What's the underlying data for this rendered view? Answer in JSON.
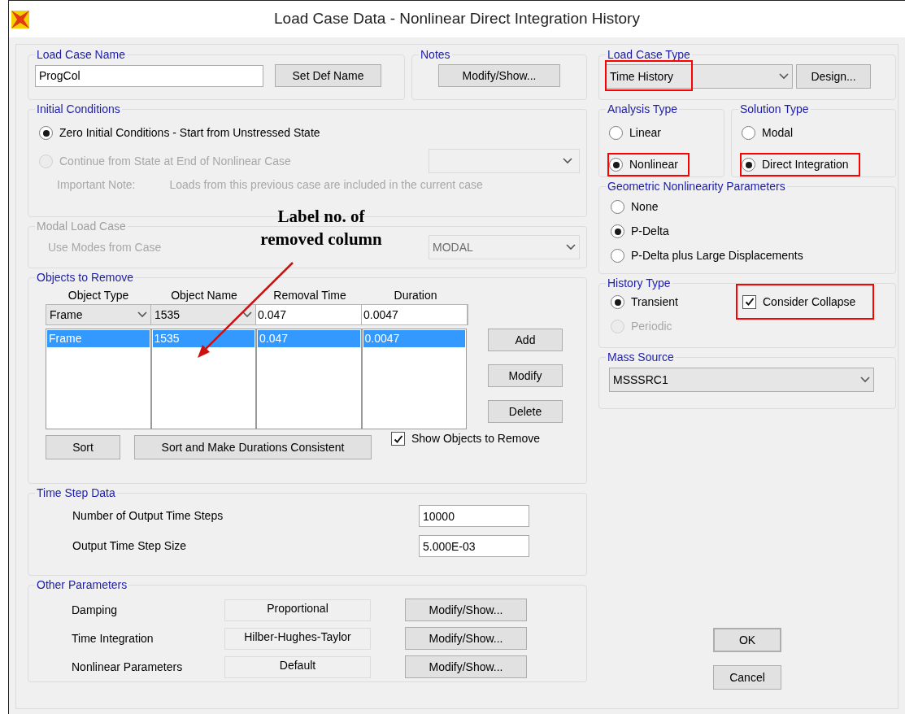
{
  "window": {
    "title": "Load Case Data - Nonlinear Direct Integration History"
  },
  "load_case_name": {
    "legend": "Load Case Name",
    "value": "ProgCol",
    "button": "Set Def Name"
  },
  "notes": {
    "legend": "Notes",
    "button": "Modify/Show..."
  },
  "initial_conditions": {
    "legend": "Initial Conditions",
    "options": [
      {
        "label": "Zero Initial Conditions - Start from Unstressed State",
        "selected": true,
        "disabled": false
      },
      {
        "label": "Continue from State at End of Nonlinear Case",
        "selected": false,
        "disabled": true
      }
    ],
    "note_label": "Important Note:",
    "note": "Loads from this previous case are included in the current case"
  },
  "modal_load_case": {
    "legend": "Modal Load Case",
    "label": "Use Modes from Case",
    "value": "MODAL",
    "disabled": true
  },
  "objects_to_remove": {
    "legend": "Objects to Remove",
    "columns": [
      "Object Type",
      "Object Name",
      "Removal Time",
      "Duration"
    ],
    "entry": [
      "Frame",
      "1535",
      "0.047",
      "0.0047"
    ],
    "rows": [
      {
        "cells": [
          "Frame",
          "1535",
          "0.047",
          "0.0047"
        ],
        "selected": true
      }
    ],
    "buttons": [
      "Add",
      "Modify",
      "Delete"
    ],
    "sort_buttons": [
      "Sort",
      "Sort and Make Durations Consistent"
    ],
    "show_objects": {
      "label": "Show Objects to Remove",
      "checked": true
    }
  },
  "time_step_data": {
    "legend": "Time Step Data",
    "fields": [
      {
        "label": "Number of Output Time Steps",
        "value": "10000"
      },
      {
        "label": "Output Time Step Size",
        "value": "5.000E-03"
      }
    ]
  },
  "other_parameters": {
    "legend": "Other Parameters",
    "rows": [
      {
        "label": "Damping",
        "value": "Proportional",
        "button": "Modify/Show..."
      },
      {
        "label": "Time Integration",
        "value": "Hilber-Hughes-Taylor",
        "button": "Modify/Show..."
      },
      {
        "label": "Nonlinear Parameters",
        "value": "Default",
        "button": "Modify/Show..."
      }
    ]
  },
  "load_case_type": {
    "legend": "Load Case Type",
    "value": "Time History",
    "highlighted": true,
    "button": "Design..."
  },
  "analysis_type": {
    "legend": "Analysis Type",
    "options": [
      {
        "label": "Linear",
        "selected": false,
        "highlighted": false
      },
      {
        "label": "Nonlinear",
        "selected": true,
        "highlighted": true
      }
    ]
  },
  "solution_type": {
    "legend": "Solution Type",
    "options": [
      {
        "label": "Modal",
        "selected": false,
        "highlighted": false
      },
      {
        "label": "Direct Integration",
        "selected": true,
        "highlighted": true
      }
    ]
  },
  "geometric_nonlinearity": {
    "legend": "Geometric Nonlinearity Parameters",
    "options": [
      {
        "label": "None",
        "selected": false
      },
      {
        "label": "P-Delta",
        "selected": true
      },
      {
        "label": "P-Delta plus Large Displacements",
        "selected": false
      }
    ]
  },
  "history_type": {
    "legend": "History Type",
    "options": [
      {
        "label": "Transient",
        "selected": true,
        "disabled": false
      },
      {
        "label": "Periodic",
        "selected": false,
        "disabled": true
      }
    ],
    "consider_collapse": {
      "label": "Consider Collapse",
      "checked": true,
      "highlighted": true
    }
  },
  "mass_source": {
    "legend": "Mass Source",
    "value": "MSSSRC1"
  },
  "buttons": [
    "OK",
    "Cancel"
  ],
  "annotation": {
    "text": "Label no. of\nremoved column"
  }
}
